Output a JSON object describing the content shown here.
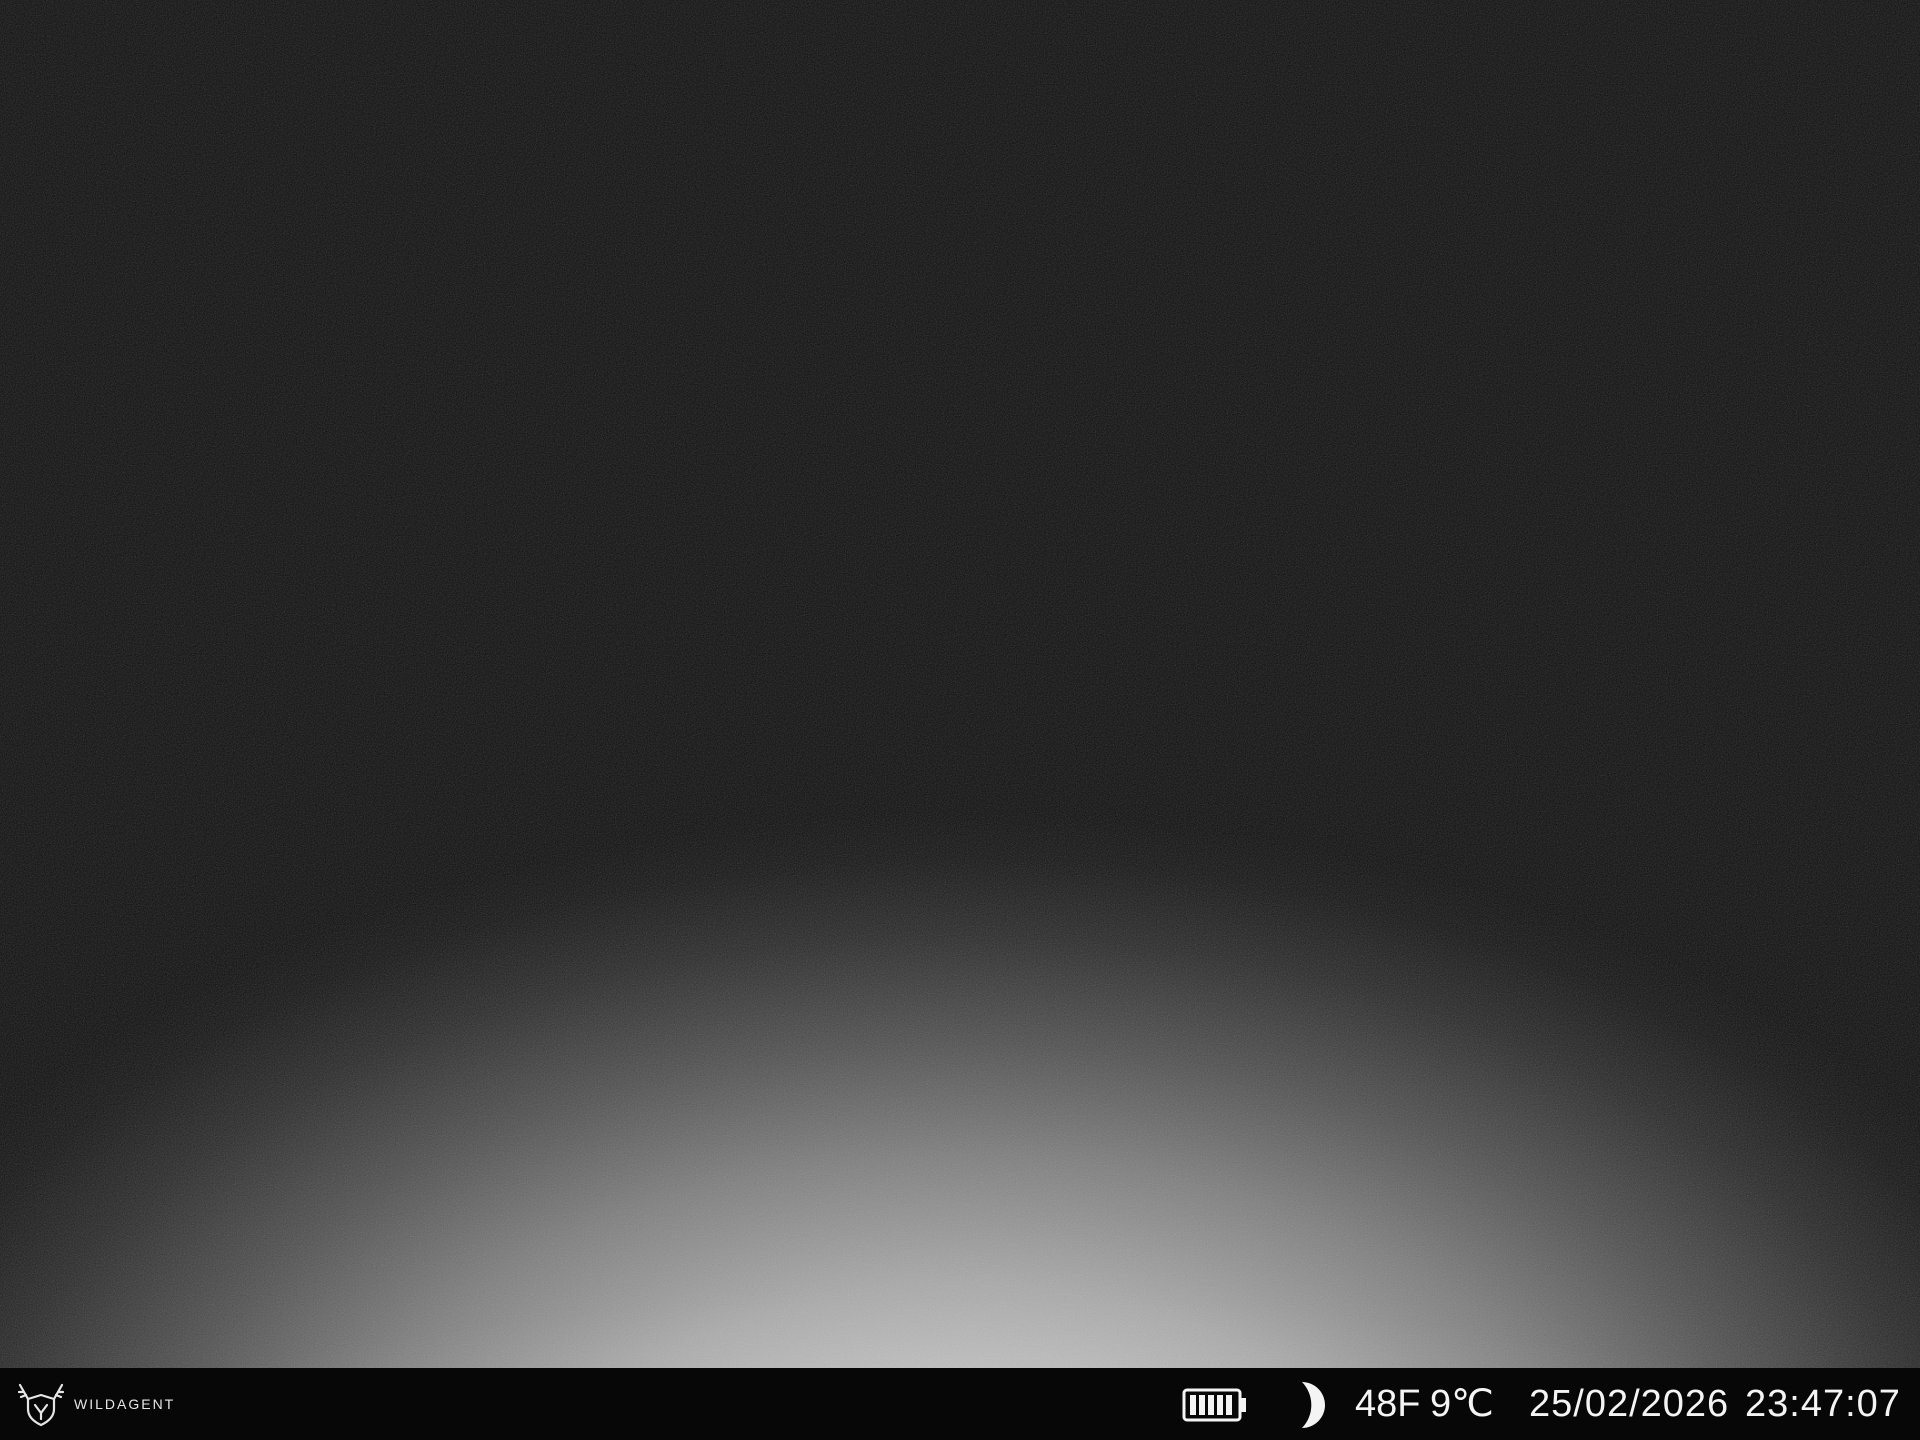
{
  "brand": {
    "name": "WILDAGENT",
    "logo_icon": "deer-antler-shield-icon"
  },
  "status": {
    "battery_icon": "battery-full-icon",
    "battery_level": 1.0,
    "moon_icon": "moon-phase-icon",
    "temperature_f": "48F",
    "temperature_c": "9℃",
    "date": "25/02/2026",
    "time": "23:47:07"
  },
  "colors": {
    "bar_background": "#070708",
    "text": "#f4f4f4"
  }
}
